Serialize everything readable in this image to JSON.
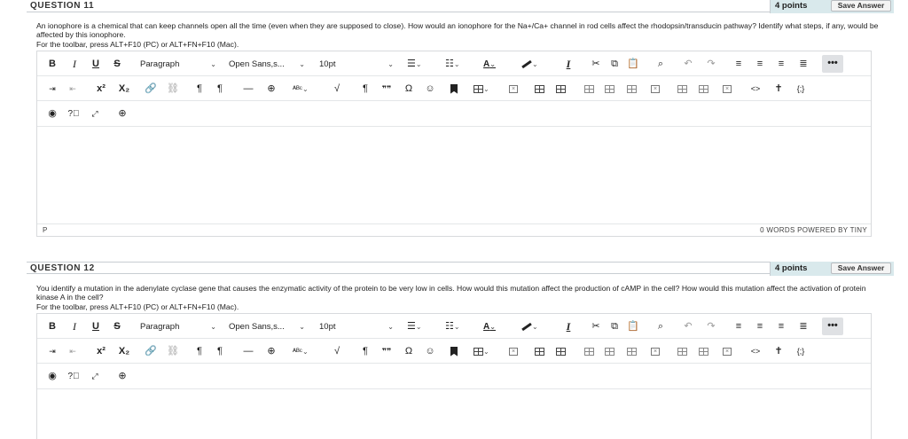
{
  "questions": [
    {
      "title": "QUESTION 11",
      "points": "4 points",
      "save_label": "Save Answer",
      "text": "An ionophore is a chemical that can keep channels open all the time (even when they are supposed to close). How would an ionophore for the Na+/Ca+ channel in rod cells affect the rhodopsin/transducin pathway? Identify what steps, if any, would be affected by this ionophore.",
      "toolbar_hint": "For the toolbar, press ALT+F10 (PC) or ALT+FN+F10 (Mac).",
      "status_path": "P",
      "status_words": "0 WORDS",
      "powered_by": "POWERED BY TINY"
    },
    {
      "title": "QUESTION 12",
      "points": "4 points",
      "save_label": "Save Answer",
      "text": "You identify a mutation in the adenylate cyclase gene that causes the enzymatic activity of the protein to be very low in cells. How would this mutation affect the production of cAMP in the cell? How would this mutation affect the activation of protein kinase A in the cell?",
      "toolbar_hint": "For the toolbar, press ALT+F10 (PC) or ALT+FN+F10 (Mac)."
    }
  ],
  "toolbar": {
    "bold": "B",
    "italic": "I",
    "underline": "U",
    "strike": "S",
    "block_format": "Paragraph",
    "font_family": "Open Sans,s...",
    "font_size": "10pt",
    "more": "•••",
    "superscript": "x²",
    "subscript": "X₂",
    "pilcrow": "¶",
    "quote": "❞❞",
    "omega": "Ω",
    "code": "<>",
    "braces": "{;}",
    "hr": "—",
    "chevron": "⌄"
  }
}
